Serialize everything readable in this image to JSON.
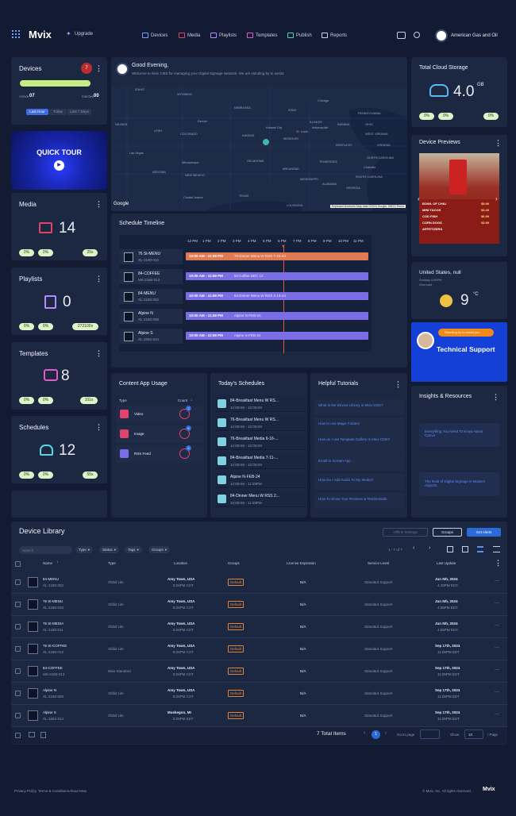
{
  "header": {
    "brand": "Mvix",
    "upgrade": "Upgrade",
    "nav": [
      "Devices",
      "Media",
      "Playlists",
      "Templates",
      "Publish",
      "Reports"
    ],
    "org": "American Gas and Oil"
  },
  "devices": {
    "title": "Devices",
    "alert_count": "7",
    "active_label": "Active",
    "active_count": "07",
    "inactive_label": "Inactive",
    "inactive_count": "00",
    "range_tabs": [
      "Last Hour",
      "Today",
      "Last 7 Days"
    ]
  },
  "quick_tour": {
    "label": "QUICK TOUR"
  },
  "stats": [
    {
      "title": "Media",
      "value": "14",
      "pills": [
        "0%",
        "0%",
        "25x"
      ]
    },
    {
      "title": "Playlists",
      "value": "0",
      "pills": [
        "0%",
        "0%",
        "272100x"
      ]
    },
    {
      "title": "Templates",
      "value": "8",
      "pills": [
        "0%",
        "0%",
        "101x"
      ]
    },
    {
      "title": "Schedules",
      "value": "12",
      "pills": [
        "0%",
        "0%",
        "55x"
      ]
    }
  ],
  "greeting": {
    "title": "Good Evening,",
    "subtitle": "Welcome to Mvix CMS for managing your Digital Signage Network. We are standing by to assist."
  },
  "map": {
    "labels": [
      "IDAHO",
      "WYOMING",
      "NEBRASKA",
      "IOWA",
      "Chicago",
      "PENNSYLVANIA",
      "NEVADA",
      "UTAH",
      "Denver",
      "COLORADO",
      "KANSAS",
      "Kansas City",
      "MISSOURI",
      "ILLINOIS",
      "INDIANA",
      "OHIO",
      "St. Louis",
      "Indianapolis",
      "WEST VIRGINIA",
      "VIRGINIA",
      "KENTUCKY",
      "Las Vegas",
      "ARIZONA",
      "Albuquerque",
      "NEW MEXICO",
      "OKLAHOMA",
      "ARKANSAS",
      "TENNESSEE",
      "Charlotte",
      "NORTH CAROLINA",
      "SOUTH CAROLINA",
      "MISSISSIPPI",
      "ALABAMA",
      "GEORGIA",
      "Ciudad Juárez",
      "TEXAS",
      "LOUISIANA"
    ],
    "attribution": "Keyboard shortcuts  Map data ©2024 Google, INEGI  Terms",
    "google": "Google"
  },
  "timeline": {
    "title": "Schedule Timeline",
    "hours": [
      "12 PM",
      "1 PM",
      "2 PM",
      "3 PM",
      "4 PM",
      "5 PM",
      "6 PM",
      "7 PM",
      "8 PM",
      "9 PM",
      "10 PM",
      "11 PM"
    ],
    "rows": [
      {
        "name": "76 St-MENU",
        "id": "XL-2180-010",
        "time": "10:00 AM - 11:59 PM",
        "label": "76-Dinner Menu W RSS 7-16-24",
        "color": "#e07a55"
      },
      {
        "name": "84-COFFEE",
        "id": "MS-2180-013",
        "time": "10:00 AM - 11:59 PM",
        "label": "84-Coffee DEC 12",
        "color": "#7a6ee6"
      },
      {
        "name": "84-MENU",
        "id": "XL-2180-002",
        "time": "10:00 AM - 11:59 PM",
        "label": "84-Dinner Menu W RSS 2-19-24",
        "color": "#7a6ee6"
      },
      {
        "name": "Alpine N",
        "id": "XL-2160-009",
        "time": "10:00 AM - 11:59 PM",
        "label": "Alpine N-FEB-24",
        "color": "#7a6ee6"
      },
      {
        "name": "Alpine S",
        "id": "XL-1552-014",
        "time": "10:00 AM - 11:59 PM",
        "label": "Alpine S-FEB-24",
        "color": "#7a6ee6"
      }
    ]
  },
  "content_usage": {
    "title": "Content App Usage",
    "col_type": "Type",
    "col_count": "Count",
    "rows": [
      {
        "label": "Video",
        "count": "2",
        "color": "#e0436b"
      },
      {
        "label": "Image",
        "count": "6",
        "color": "#e0436b"
      },
      {
        "label": "RSS Feed",
        "count": "6",
        "color": "#7a6ee6"
      }
    ]
  },
  "todays_schedules": {
    "title": "Today's Schedules",
    "items": [
      {
        "name": "84-Breakfast Menu W RS...",
        "time": "12:00AM - 10:00AM"
      },
      {
        "name": "76-Breakfast Menu W RS...",
        "time": "12:00AM - 10:00AM"
      },
      {
        "name": "76-Breakfast Media 6-16-...",
        "time": "12:00AM - 10:00AM"
      },
      {
        "name": "84-Breakfast Media 7-11-...",
        "time": "12:00AM - 10:00AM"
      },
      {
        "name": "Alpine N-FEB-24",
        "time": "12:00AM - 11:59PM"
      },
      {
        "name": "84-Dinner Menu W RSS 2...",
        "time": "10:00AM - 11:59PM"
      }
    ]
  },
  "tutorials": {
    "title": "Helpful Tutorials",
    "items": [
      "What is the Device Library in Mvix CMS?",
      "How to use Magic Folders",
      "How do I use Template Gallery in Mvix CMS?",
      "Email to Screen App",
      "How Do I Add Audio To My Media?",
      "How To Show Your Reviews & Testimonials"
    ]
  },
  "cloud": {
    "title": "Total Cloud Storage",
    "value": "4.0",
    "unit": "GB",
    "pills": [
      "0%",
      "0%",
      "0%"
    ]
  },
  "previews": {
    "title": "Device Previews",
    "menu_rows": [
      "BOWL OF CHILI",
      "MINI TACOS",
      "COD FISH",
      "CORN DOGS",
      "APPETIZERS"
    ],
    "menu_prices": [
      "$5.99",
      "$4.49",
      "$6.99",
      "$3.99"
    ]
  },
  "weather": {
    "location": "United States, null",
    "day": "Sunday 4:20PM",
    "condition": "Overcast",
    "temp": "9",
    "unit": "°C"
  },
  "support": {
    "bubble": "Standing by to assist you",
    "title": "Technical Support"
  },
  "insights": {
    "title": "Insights & Resources",
    "items": [
      "Everything You Need To Know About Canva",
      "The Role of Digital Signage in Modern Airports"
    ]
  },
  "library": {
    "title": "Device Library",
    "btn_offline": "Offline Settings",
    "btn_groups": "Groups",
    "btn_get": "Get Alerts",
    "search_placeholder": "Search",
    "filters": [
      "Type",
      "Status",
      "Tags",
      "Groups"
    ],
    "paging": "1 - 7 of 7",
    "columns": [
      "Name",
      "Type",
      "Location",
      "Groups",
      "License Expiration",
      "Service Level",
      "Last Update"
    ],
    "rows": [
      {
        "name": "84-MENU",
        "id": "XL-2180-002",
        "type": "Xhibit Lite",
        "loc": "Amy Town, USA",
        "loc2": "8:28PM CST",
        "group": "Default",
        "lic": "N/A",
        "svc": "Standard Support",
        "date": "Jun 5th, 2024",
        "time": "4:49PM EDT"
      },
      {
        "name": "76 St-MENU",
        "id": "XL-2180-010",
        "type": "Xhibit Lite",
        "loc": "Amy Town, USA",
        "loc2": "8:28PM CST",
        "group": "Default",
        "lic": "N/A",
        "svc": "Standard Support",
        "date": "Jun 5th, 2024",
        "time": "4:55PM EDT"
      },
      {
        "name": "76 St-MEDIA",
        "id": "XL-2180-011",
        "type": "Xhibit Lite",
        "loc": "Amy Town, USA",
        "loc2": "8:28PM CST",
        "group": "Default",
        "lic": "N/A",
        "svc": "Standard Support",
        "date": "Jun 5th, 2024",
        "time": "4:55PM EDT"
      },
      {
        "name": "76 St-COFFEE",
        "id": "XL-2180-012",
        "type": "Xhibit Lite",
        "loc": "Amy Town, USA",
        "loc2": "8:28PM CST",
        "group": "Default",
        "lic": "N/A",
        "svc": "Standard Support",
        "date": "Sep 17th, 2024",
        "time": "11:08PM EDT"
      },
      {
        "name": "84-COFFEE",
        "id": "MS-2180-013",
        "type": "Mvix Standard",
        "loc": "Amy Town, USA",
        "loc2": "8:28PM CST",
        "group": "Default",
        "lic": "N/A",
        "svc": "Standard Support",
        "date": "Sep 17th, 2024",
        "time": "11:08PM EDT"
      },
      {
        "name": "Alpine N",
        "id": "XL-2160-009",
        "type": "Xhibit Lite",
        "loc": "Amy Town, USA",
        "loc2": "8:28PM CST",
        "group": "Default",
        "lic": "N/A",
        "svc": "Standard Support",
        "date": "Sep 17th, 2024",
        "time": "11:08PM EDT"
      },
      {
        "name": "Alpine S",
        "id": "XL-1552-014",
        "type": "Xhibit Lite",
        "loc": "Muskegon, MI",
        "loc2": "8:28PM EST",
        "group": "Default",
        "lic": "N/A",
        "svc": "Standard Support",
        "date": "Sep 17th, 2024",
        "time": "11:08PM EDT"
      }
    ],
    "total": "7 Total Items",
    "page": "1",
    "goto": "Go to page",
    "show": "Show",
    "per": "10",
    "per_suffix": "/ Page"
  },
  "footer": {
    "links": [
      "Privacy Policy",
      "Terms & Conditions",
      "About Mvix"
    ],
    "copyright": "© Mvix, Inc. All rights reserved.",
    "brand": "Mvix"
  }
}
